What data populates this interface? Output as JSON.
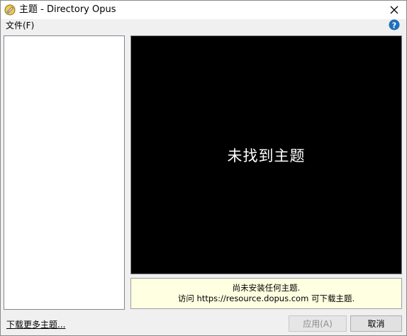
{
  "window": {
    "title": "主题 - Directory Opus"
  },
  "menubar": {
    "file_label": "文件(F)"
  },
  "preview": {
    "message": "未找到主题"
  },
  "info": {
    "line1": "尚未安装任何主题.",
    "line2": "访问 https://resource.dopus.com 可下载主题."
  },
  "footer": {
    "download_link": "下载更多主题...",
    "apply_label": "应用(A)",
    "cancel_label": "取消"
  },
  "colors": {
    "preview_bg": "#000000",
    "info_bg": "#ffffe1",
    "help_icon": "#1e6fb8"
  },
  "icons": {
    "app": "directory-opus-icon",
    "close": "close-icon",
    "help": "help-icon"
  }
}
